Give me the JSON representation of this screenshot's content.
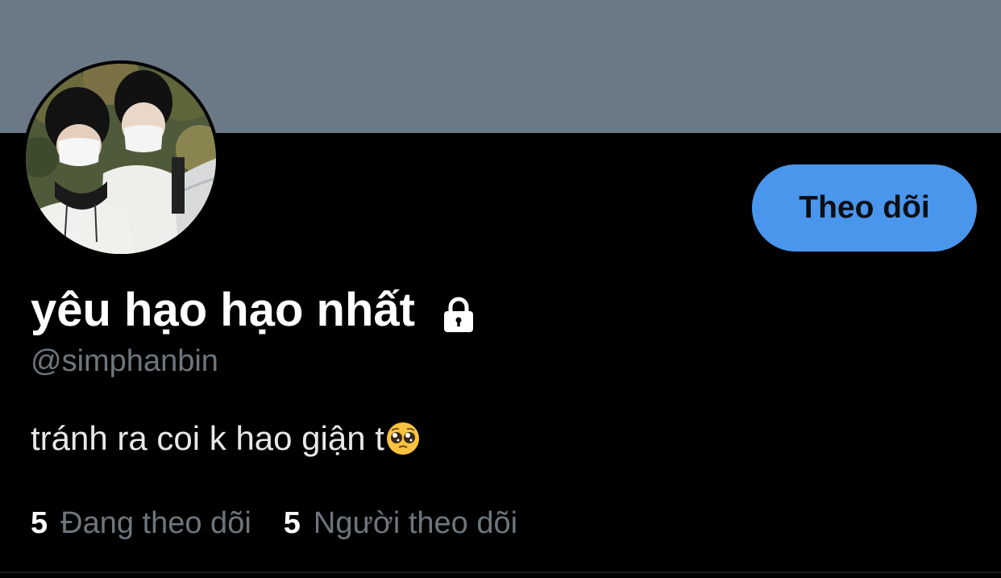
{
  "profile": {
    "display_name": "yêu hạo hạo nhất",
    "handle": "@simphanbin",
    "bio": "tránh ra coi k hao giận t",
    "bio_emoji": "pleading-face-icon",
    "protected_icon": "lock-icon",
    "follow_button_label": "Theo dõi"
  },
  "stats": {
    "following_count": "5",
    "following_label": "Đang theo dõi",
    "followers_count": "5",
    "followers_label": "Người theo dõi"
  },
  "colors": {
    "banner": "#6b7885",
    "background": "#000000",
    "accent_button": "#4a96ec",
    "secondary_text": "#6e767d",
    "primary_text": "#ffffff"
  }
}
